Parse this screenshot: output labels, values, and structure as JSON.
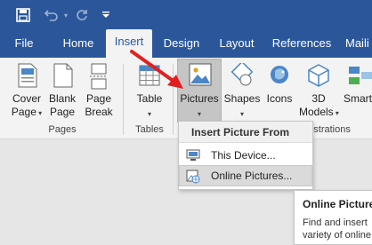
{
  "ribbon_tabs": [
    {
      "label": "File"
    },
    {
      "label": "Home"
    },
    {
      "label": "Insert"
    },
    {
      "label": "Design"
    },
    {
      "label": "Layout"
    },
    {
      "label": "References"
    },
    {
      "label": "Maili"
    }
  ],
  "active_tab": "Insert",
  "groups": {
    "pages": {
      "label": "Pages",
      "commands": {
        "cover_page": {
          "line1": "Cover",
          "line2": "Page"
        },
        "blank_page": {
          "line1": "Blank",
          "line2": "Page"
        },
        "page_break": {
          "line1": "Page",
          "line2": "Break"
        }
      }
    },
    "tables": {
      "label": "Tables",
      "table": "Table"
    },
    "illustrations": {
      "label": "ustrations",
      "pictures": "Pictures",
      "shapes": "Shapes",
      "icons": "Icons",
      "models": {
        "line1": "3D",
        "line2": "Models"
      },
      "smart": "Smart"
    }
  },
  "dropdown": {
    "header": "Insert Picture From",
    "items": [
      {
        "label": "This Device..."
      },
      {
        "label": "Online Pictures..."
      }
    ]
  },
  "tooltip": {
    "title": "Online Picture",
    "body": "Find and insert variety of online"
  },
  "colors": {
    "ribbon_blue": "#2b579a",
    "arrow_red": "#e02020"
  }
}
